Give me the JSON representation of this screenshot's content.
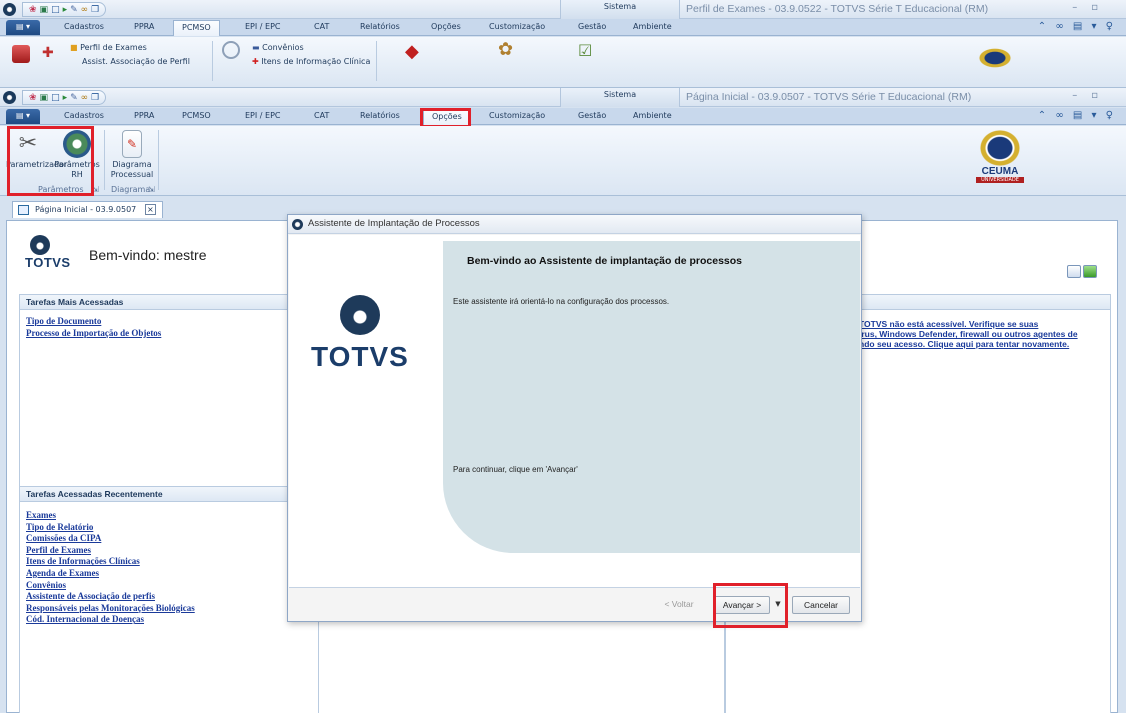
{
  "window1": {
    "system_tab": "Sistema",
    "title": "Perfil de Exames - 03.9.0522 - TOTVS Série T Educacional (RM)",
    "tabs": [
      "Cadastros",
      "PPRA",
      "PCMSO",
      "EPI / EPC",
      "CAT",
      "Relatórios",
      "Opções",
      "Customização",
      "Gestão",
      "Ambiente"
    ],
    "active_tab": "PCMSO",
    "ribbon_items": [
      "Perfil de Exames",
      "Assist. Associação de Perfil",
      "Convênios",
      "Itens de Informação Clínica"
    ]
  },
  "window2": {
    "system_tab": "Sistema",
    "title": "Página Inicial - 03.9.0507 - TOTVS Série T Educacional (RM)",
    "tabs": [
      "Cadastros",
      "PPRA",
      "PCMSO",
      "EPI / EPC",
      "CAT",
      "Relatórios",
      "Opções",
      "Customização",
      "Gestão",
      "Ambiente"
    ],
    "active_tab": "Opções",
    "ribbon": {
      "parametrizador": "Parametrizador",
      "parametros_rh_1": "Parâmetros",
      "parametros_rh_2": "RH",
      "diagrama_1": "Diagrama",
      "diagrama_2": "Processual",
      "group_parametros": "Parâmetros",
      "group_diagrama": "Diagrama"
    },
    "brand": "CEUMA",
    "brand_sub": "UNIVERSIDADE"
  },
  "doc_tab": {
    "label": "Página Inicial - 03.9.0507",
    "close": "×"
  },
  "home": {
    "logo_text": "TOTVS",
    "welcome": "Bem-vindo: mestre",
    "most_accessed": {
      "title": "Tarefas Mais Acessadas",
      "items": [
        "Tipo de Documento",
        "Processo de Importação de Objetos"
      ]
    },
    "recent": {
      "title": "Tarefas Acessadas Recentemente",
      "items": [
        "Exames",
        "Tipo de Relatório",
        "Comissões da CIPA",
        "Perfil de Exames",
        "Itens de Informações Clínicas",
        "Agenda de Exames",
        "Convênios",
        "Assistente de Associação de perfis",
        "Responsáveis pelas Monitorações Biológicas",
        "Cód. Internacional de Doenças"
      ]
    },
    "warning_lines": [
      "TOTVS não está acessível. Verifique se suas",
      "írus, Windows Defender, firewall ou outros agentes de",
      "ndo seu acesso. Clique aqui para tentar novamente."
    ]
  },
  "dialog": {
    "title": "Assistente de Implantação de Processos",
    "logo_text": "TOTVS",
    "heading": "Bem-vindo ao Assistente de implantação de processos",
    "description": "Este assistente irá orientá-lo na configuração dos processos.",
    "continue_text": "Para continuar, clique em 'Avançar'",
    "back_button": "< Voltar",
    "next_button": "Avançar >",
    "dropdown_arrow": "▼",
    "cancel_button": "Cancelar"
  },
  "colors": {
    "highlight": "#e0202a",
    "link": "#1a3a9a",
    "ribbon_bg": "#dbe6f3",
    "dialog_panel": "#d4e2e7",
    "brand_navy": "#1b3d6a"
  }
}
